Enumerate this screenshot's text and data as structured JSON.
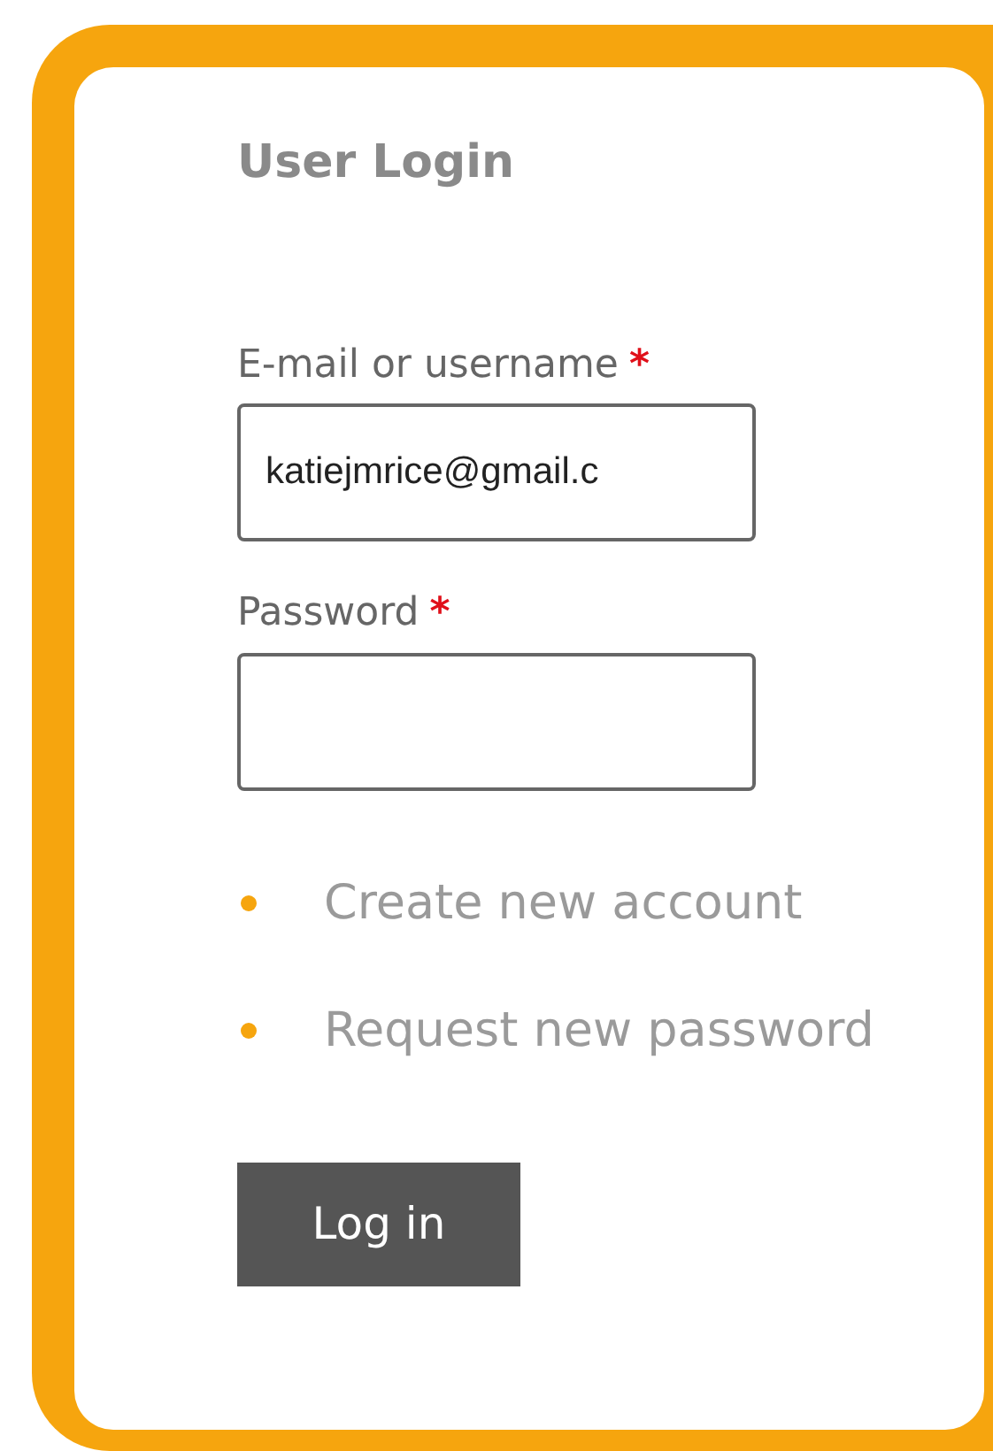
{
  "title": "User Login",
  "fields": [
    {
      "label": "E-mail or username",
      "required_mark": "*",
      "value": "katiejmrice@gmail.c",
      "kind": "text"
    },
    {
      "label": "Password",
      "required_mark": "*",
      "kind": "password"
    }
  ],
  "links": [
    "Create new account",
    "Request new password"
  ],
  "button": "Log in"
}
